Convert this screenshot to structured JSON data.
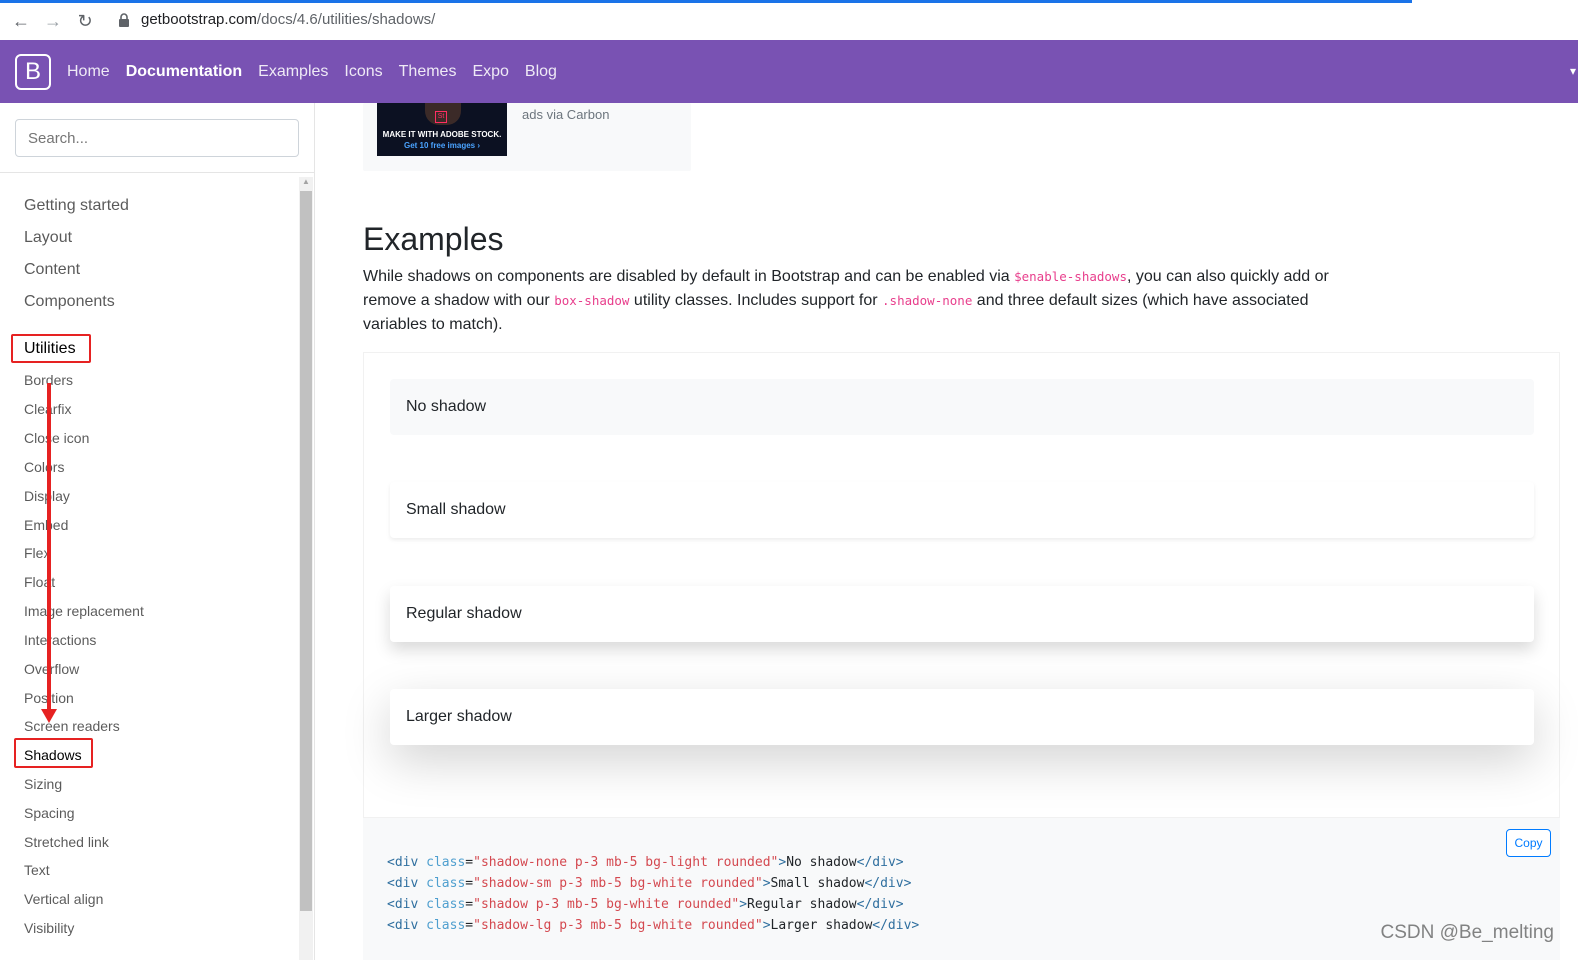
{
  "browser": {
    "url_host": "getbootstrap.com",
    "url_path": "/docs/4.6/utilities/shadows/"
  },
  "navbar": {
    "brand": "B",
    "links": [
      "Home",
      "Documentation",
      "Examples",
      "Icons",
      "Themes",
      "Expo",
      "Blog"
    ],
    "active": "Documentation"
  },
  "sidebar": {
    "search_placeholder": "Search...",
    "sections": [
      "Getting started",
      "Layout",
      "Content",
      "Components",
      "Utilities"
    ],
    "active_section": "Utilities",
    "utilities": [
      "Borders",
      "Clearfix",
      "Close icon",
      "Colors",
      "Display",
      "Embed",
      "Flex",
      "Float",
      "Image replacement",
      "Interactions",
      "Overflow",
      "Position",
      "Screen readers",
      "Shadows",
      "Sizing",
      "Spacing",
      "Stretched link",
      "Text",
      "Vertical align",
      "Visibility"
    ],
    "active_item": "Shadows"
  },
  "ad": {
    "line1": "MAKE IT WITH ADOBE STOCK.",
    "line2": "Get 10 free images ›",
    "logo": "St",
    "credit": "ads via Carbon"
  },
  "content": {
    "heading": "Examples",
    "p1": "While shadows on components are disabled by default in Bootstrap and can be enabled via ",
    "code1": "$enable-shadows",
    "p2": ", you can also quickly add or remove a shadow with our ",
    "code2": "box-shadow",
    "p3": " utility classes. Includes support for ",
    "code3": ".shadow-none",
    "p4": " and three default sizes (which have associated variables to match).",
    "examples": [
      "No shadow",
      "Small shadow",
      "Regular shadow",
      "Larger shadow"
    ],
    "copy_label": "Copy",
    "code_lines": [
      {
        "class": "shadow-none p-3 mb-5 bg-light rounded",
        "text": "No shadow"
      },
      {
        "class": "shadow-sm p-3 mb-5 bg-white rounded",
        "text": "Small shadow"
      },
      {
        "class": "shadow p-3 mb-5 bg-white rounded",
        "text": "Regular shadow"
      },
      {
        "class": "shadow-lg p-3 mb-5 bg-white rounded",
        "text": "Larger shadow"
      }
    ]
  },
  "watermark": "CSDN @Be_melting",
  "colors": {
    "brand_purple": "#7952b3",
    "annotation_red": "#e62222",
    "code_pink": "#e83e8c"
  }
}
